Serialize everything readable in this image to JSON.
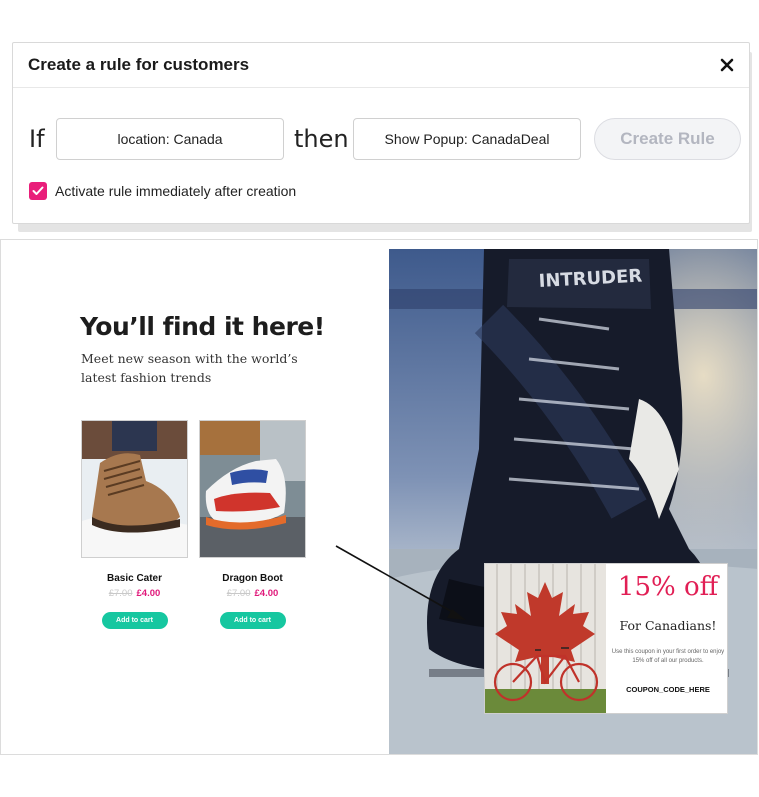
{
  "dialog": {
    "title": "Create a rule for customers",
    "close_icon": "close-icon",
    "if_word": "If",
    "condition_value": "location: Canada",
    "then_word": "then",
    "action_value": "Show Popup: CanadaDeal",
    "create_button": "Create Rule",
    "activate_checked": true,
    "activate_label": "Activate rule immediately after creation",
    "accent_color": "#e91e7a"
  },
  "store": {
    "hero_title": "You’ll find it here!",
    "hero_subtitle": "Meet new season with the world’s latest fashion trends",
    "products": [
      {
        "name": "Basic Cater",
        "old_price": "£7.00",
        "new_price": "£4.00",
        "cart_label": "Add to cart",
        "image": "brown-hiking-boot"
      },
      {
        "name": "Dragon Boot",
        "old_price": "£7.00",
        "new_price": "£4.00",
        "cart_label": "Add to cart",
        "image": "red-white-sneaker"
      }
    ],
    "hero_image": "ice-skate-photo",
    "hero_image_text": "INTRUDER",
    "price_color": "#e0187a",
    "button_color": "#16c7a0"
  },
  "popup": {
    "image": "canada-flag-bicycle",
    "discount": "15% off",
    "headline": "For Canadians!",
    "body": "Use this coupon in your first order to enjoy 15% off of all our products.",
    "code": "COUPON_CODE_HERE",
    "discount_color": "#e11f55"
  }
}
